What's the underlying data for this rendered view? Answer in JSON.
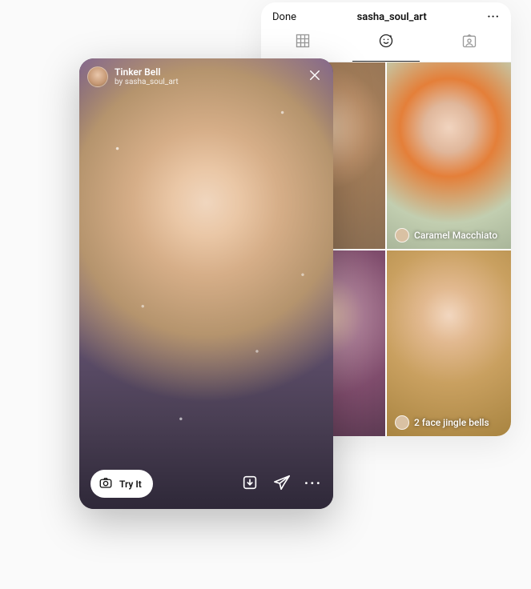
{
  "gallery": {
    "done_label": "Done",
    "username": "sasha_soul_art",
    "more_label": "···",
    "tabs": {
      "grid": "grid-icon",
      "effects": "effects-icon",
      "tagged": "tagged-icon"
    },
    "tiles": [
      {
        "label": ""
      },
      {
        "label": "Caramel Macchiato"
      },
      {
        "label": ""
      },
      {
        "label": "2 face jingle bells"
      }
    ]
  },
  "preview": {
    "filter_name": "Tinker Bell",
    "author_prefix": "by ",
    "author": "sasha_soul_art",
    "try_label": "Try It",
    "more_label": "···"
  }
}
